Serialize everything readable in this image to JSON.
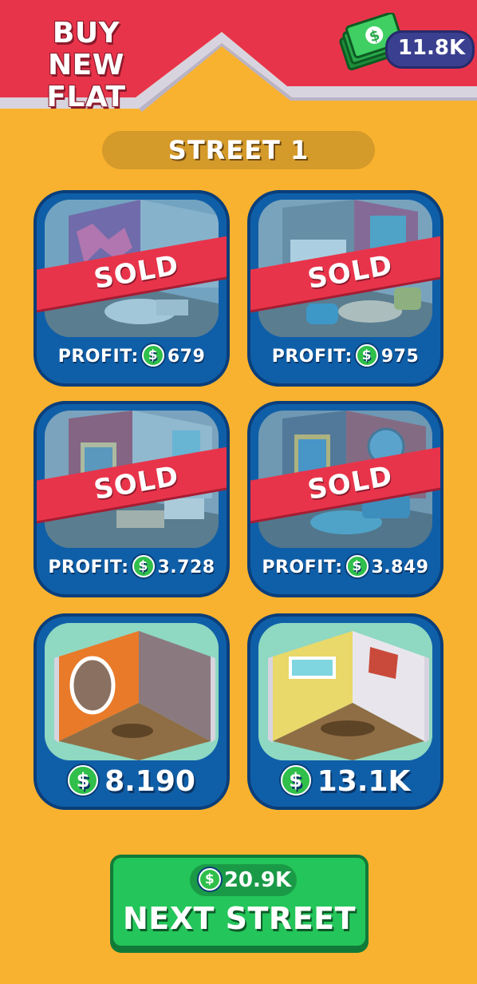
{
  "header": {
    "title": "BUY NEW FLAT",
    "money": "11.8K",
    "dollar_symbol": "$"
  },
  "street": {
    "label": "STREET 1"
  },
  "flats": [
    {
      "status": "SOLD",
      "profit_label": "PROFIT:",
      "profit_value": "679"
    },
    {
      "status": "SOLD",
      "profit_label": "PROFIT:",
      "profit_value": "975"
    },
    {
      "status": "SOLD",
      "profit_label": "PROFIT:",
      "profit_value": "3.728"
    },
    {
      "status": "SOLD",
      "profit_label": "PROFIT:",
      "profit_value": "3.849"
    },
    {
      "price": "8.190"
    },
    {
      "price": "13.1K"
    }
  ],
  "next_street": {
    "cost": "20.9K",
    "label": "NEXT STREET"
  },
  "colors": {
    "header_red": "#e8344a",
    "background": "#f9b22f",
    "card_blue": "#0f5fa8",
    "button_green": "#24c55a"
  }
}
